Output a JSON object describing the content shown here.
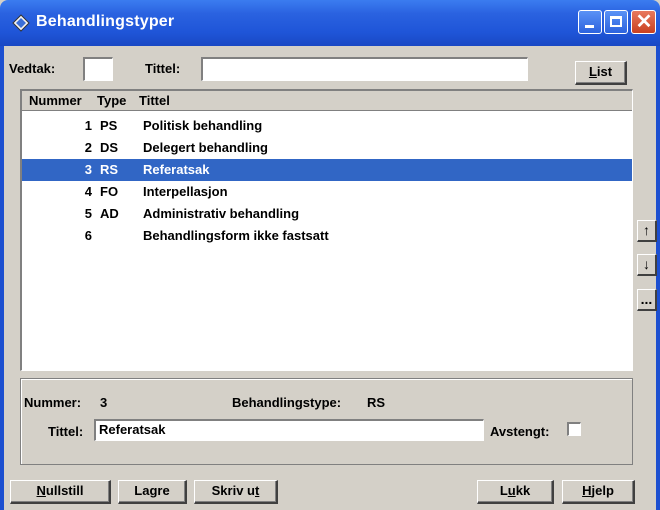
{
  "window": {
    "title": "Behandlingstyper"
  },
  "search": {
    "vedtak_label": "Vedtak:",
    "vedtak_value": "",
    "tittel_label": "Tittel:",
    "tittel_value": "",
    "list_button_u": "L",
    "list_button_rest": "ist"
  },
  "list": {
    "headers": {
      "number": "Nummer",
      "type": "Type",
      "title": "Tittel"
    },
    "rows": [
      {
        "number": "1",
        "type": "PS",
        "title": "Politisk behandling",
        "selected": false
      },
      {
        "number": "2",
        "type": "DS",
        "title": "Delegert behandling",
        "selected": false
      },
      {
        "number": "3",
        "type": "RS",
        "title": "Referatsak",
        "selected": true
      },
      {
        "number": "4",
        "type": "FO",
        "title": "Interpellasjon",
        "selected": false
      },
      {
        "number": "5",
        "type": "AD",
        "title": "Administrativ behandling",
        "selected": false
      },
      {
        "number": "6",
        "type": "",
        "title": "Behandlingsform ikke fastsatt",
        "selected": false
      }
    ]
  },
  "side_buttons": {
    "up": "↑",
    "down": "↓",
    "more": "..."
  },
  "detail": {
    "nummer_label": "Nummer:",
    "nummer_value": "3",
    "behandlingstype_label": "Behandlingstype:",
    "behandlingstype_value": "RS",
    "tittel_label": "Tittel:",
    "tittel_value": "Referatsak",
    "avstengt_label": "Avstengt:",
    "avstengt_checked": false
  },
  "footer": {
    "nullstill_u": "N",
    "nullstill_rest": "ullstill",
    "lagre": "Lagre",
    "skriv_ut_pre": "Skriv u",
    "skriv_ut_u": "t",
    "lukk_pre": "L",
    "lukk_u": "u",
    "lukk_post": "kk",
    "hjelp_u": "H",
    "hjelp_rest": "jelp"
  },
  "colors": {
    "titlebar": "#2a62e0",
    "selection": "#3166c5",
    "face": "#d4d0c8"
  }
}
